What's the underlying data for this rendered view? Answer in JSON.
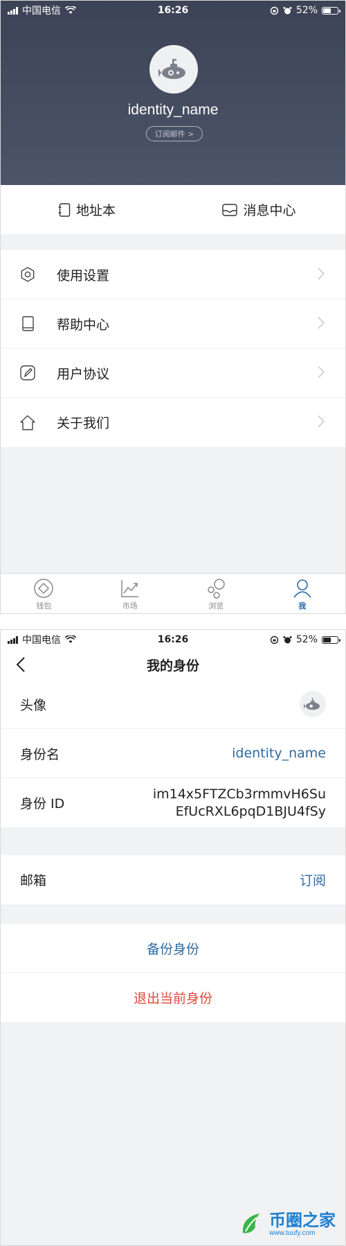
{
  "status_bar": {
    "carrier": "中国电信",
    "time": "16:26",
    "battery": "52%",
    "battery_level": 0.52
  },
  "profile": {
    "identity_name": "identity_name",
    "subscribe_mail": "订阅邮件 >"
  },
  "quick_actions": {
    "address_book": "地址本",
    "message_center": "消息中心"
  },
  "menu": [
    {
      "label": "使用设置",
      "icon": "gear-icon"
    },
    {
      "label": "帮助中心",
      "icon": "book-icon"
    },
    {
      "label": "用户协议",
      "icon": "pen-icon"
    },
    {
      "label": "关于我们",
      "icon": "home-icon"
    }
  ],
  "tabbar": [
    {
      "label": "钱包",
      "icon": "wallet-icon",
      "active": false
    },
    {
      "label": "市场",
      "icon": "chart-icon",
      "active": false
    },
    {
      "label": "浏览",
      "icon": "browse-icon",
      "active": false
    },
    {
      "label": "我",
      "icon": "user-icon",
      "active": true
    }
  ],
  "identity_page": {
    "title": "我的身份",
    "avatar_label": "头像",
    "name_label": "身份名",
    "name_value": "identity_name",
    "id_label": "身份 ID",
    "id_value_line1": "im14x5FTZCb3rmmvH6Su",
    "id_value_line2": "EfUcRXL6pqD1BJU4fSy",
    "email_label": "邮箱",
    "email_value": "订阅",
    "backup": "备份身份",
    "logout": "退出当前身份"
  },
  "watermark": {
    "title": "币圈之家",
    "url": "www.tuufy.com"
  },
  "colors": {
    "header_bg": "#3c4356",
    "accent_blue": "#2e6aa0",
    "danger_red": "#e0473a",
    "page_bg": "#f1f2f4"
  }
}
